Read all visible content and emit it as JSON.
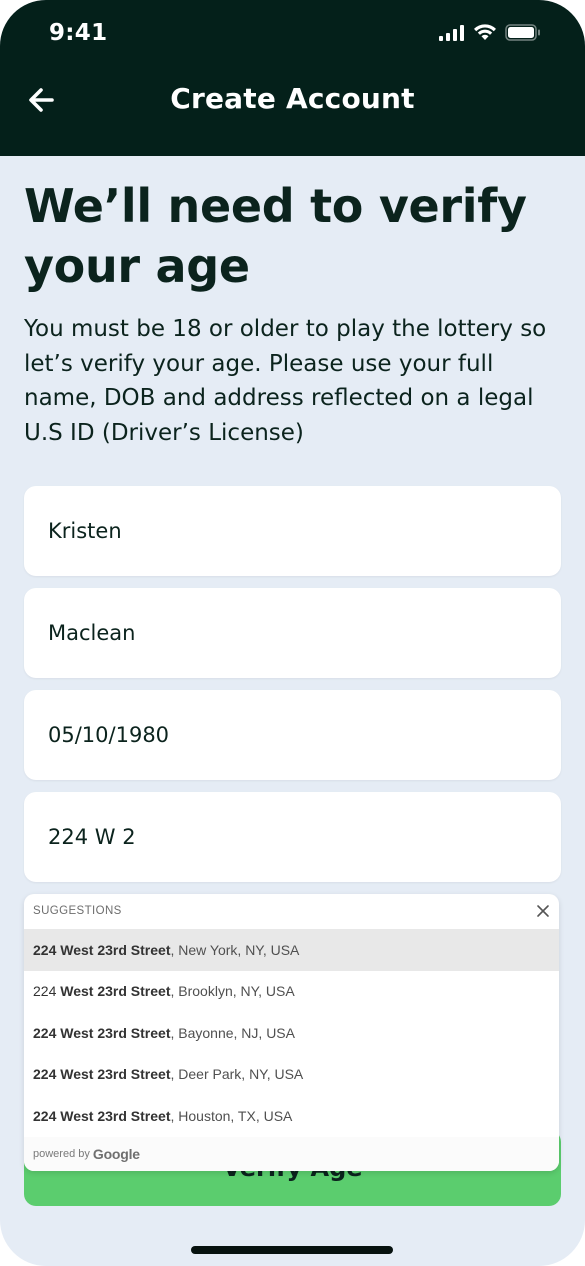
{
  "status_bar": {
    "time": "9:41"
  },
  "header": {
    "title": "Create Account"
  },
  "content": {
    "headline": "We’ll need to verify your age",
    "subtext": "You must be 18 or older to play the lottery so let’s verify your age. Please use your full name, DOB and address reflected on a legal U.S ID (Driver’s License)"
  },
  "form": {
    "first_name": "Kristen",
    "last_name": "Maclean",
    "dob": "05/10/1980",
    "address": "224 W 2"
  },
  "suggestions": {
    "label": "SUGGESTIONS",
    "items": [
      {
        "num": "224",
        "street": "West 23rd Street",
        "rest": ", New York, NY, USA"
      },
      {
        "num": "224",
        "street": "West 23rd Street",
        "rest": ", Brooklyn, NY, USA"
      },
      {
        "num": "224",
        "street": "West 23rd Street",
        "rest": ", Bayonne, NJ, USA"
      },
      {
        "num": "224",
        "street": "West 23rd Street",
        "rest": ", Deer Park, NY, USA"
      },
      {
        "num": "224",
        "street": "West 23rd Street",
        "rest": ", Houston, TX, USA"
      }
    ],
    "powered_by": "powered by",
    "brand": "Google"
  },
  "cta": {
    "label": "Verify Age"
  },
  "colors": {
    "header_bg": "#04201a",
    "page_bg": "#e5ecf5",
    "cta_bg": "#5bcd6e"
  }
}
